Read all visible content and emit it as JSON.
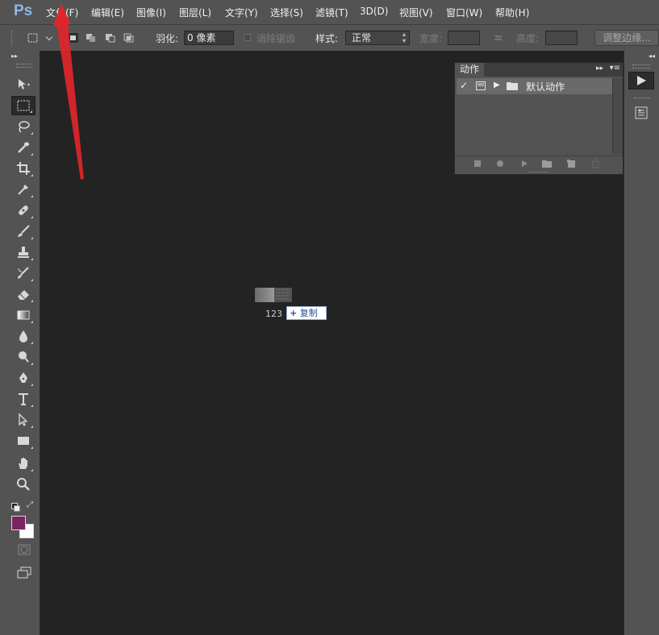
{
  "app": {
    "logo": "Ps"
  },
  "menu": [
    {
      "label": "文件(F)"
    },
    {
      "label": "编辑(E)"
    },
    {
      "label": "图像(I)"
    },
    {
      "label": "图层(L)"
    },
    {
      "label": "文字(Y)"
    },
    {
      "label": "选择(S)"
    },
    {
      "label": "滤镜(T)"
    },
    {
      "label": "3D(D)"
    },
    {
      "label": "视图(V)"
    },
    {
      "label": "窗口(W)"
    },
    {
      "label": "帮助(H)"
    }
  ],
  "options": {
    "feather_label": "羽化:",
    "feather_value": "0 像素",
    "antialias_label": "消除锯齿",
    "style_label": "样式:",
    "style_value": "正常",
    "width_label": "宽度:",
    "height_label": "高度:",
    "refine_edge_label": "调整边缘..."
  },
  "actions_panel": {
    "tab_label": "动作",
    "set_name": "默认动作"
  },
  "drag": {
    "label": "123",
    "badge": "复制",
    "badge_icon": "plus-icon"
  },
  "colors": {
    "foreground": "#7b2462",
    "background": "#ffffff",
    "annotation_arrow": "#e0262b",
    "logo": "#8fb7e4"
  }
}
